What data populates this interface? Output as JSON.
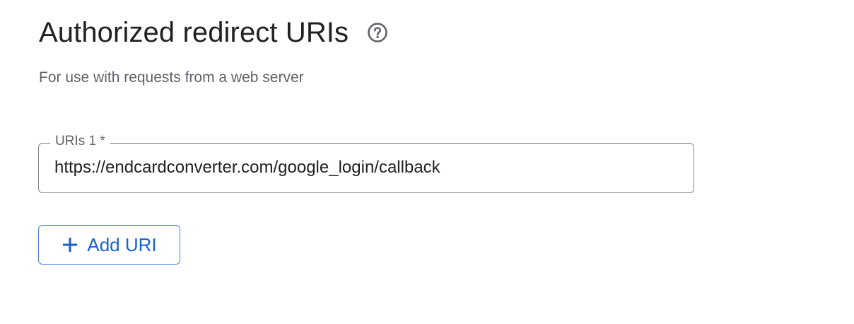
{
  "section": {
    "title": "Authorized redirect URIs",
    "help_icon": "help-circle-icon",
    "subtitle": "For use with requests from a web server"
  },
  "uri_field": {
    "label": "URIs 1 *",
    "value": "https://endcardconverter.com/google_login/callback"
  },
  "add_button": {
    "icon": "plus-icon",
    "label": "Add URI"
  },
  "colors": {
    "title_text": "#202124",
    "secondary_text": "#5f6368",
    "field_border": "#80868b",
    "accent": "#1a5fd3",
    "button_border": "#4a7de3"
  }
}
